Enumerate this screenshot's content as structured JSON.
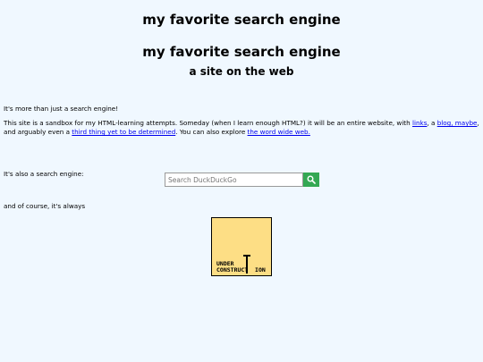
{
  "page": {
    "title": "my favorite search engine"
  },
  "header": {
    "heading": "my favorite search engine",
    "subheading": "a site on the web"
  },
  "intro": {
    "tagline": "It's more than just a search engine!",
    "text_1": "This site is a sandbox for my HTML-learning attempts. Someday (when I learn enough HTML?) it will be an entire website, with ",
    "link_links": "links",
    "text_2": ", a ",
    "link_blog": "blog, maybe",
    "text_3": ", and arguably even a ",
    "link_third": "third thing yet to be determined",
    "text_4": ". You can also explore ",
    "link_www": "the word wide web.",
    "search_intro": "It's also a search engine:"
  },
  "search": {
    "placeholder": "Search DuckDuckGo",
    "button_icon": "magnifier-icon",
    "button_color": "#34a853"
  },
  "footer": {
    "always_text": "and of course, it's always",
    "sign_line_1": "UNDER",
    "sign_line_2": "CONSTRUCT  ION",
    "sign_color": "#fdde85"
  },
  "colors": {
    "background": "#f0f8ff",
    "link": "#0000ee"
  }
}
